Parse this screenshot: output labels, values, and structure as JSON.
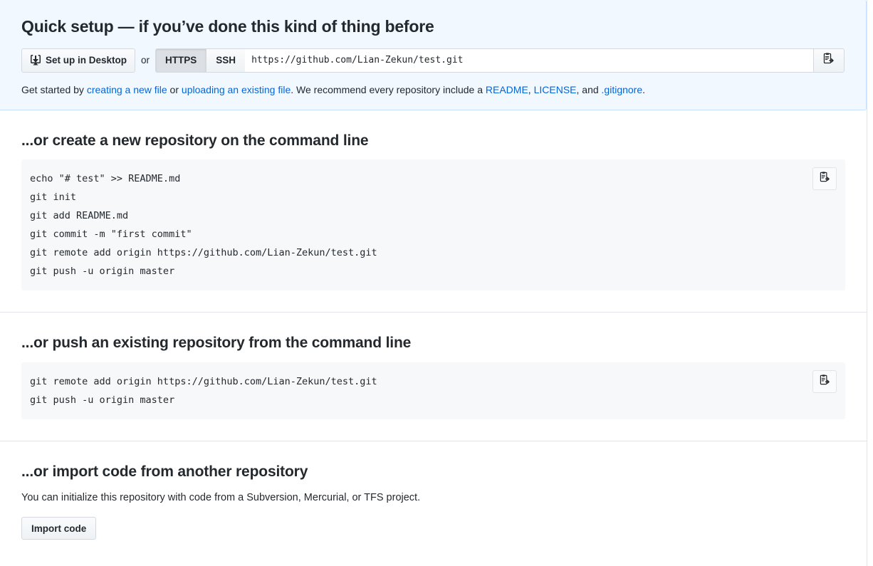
{
  "quick_setup": {
    "title": "Quick setup — if you’ve done this kind of thing before",
    "desktop_button_label": "Set up in Desktop",
    "or_label": "or",
    "protocol_https": "HTTPS",
    "protocol_ssh": "SSH",
    "selected_protocol": "HTTPS",
    "clone_url": "https://github.com/Lian-Zekun/test.git",
    "hint": {
      "prefix": "Get started by ",
      "link_new_file": "creating a new file",
      "mid_or": " or ",
      "link_upload": "uploading an existing file",
      "middle": ". We recommend every repository include a ",
      "link_readme": "README",
      "sep1": ", ",
      "link_license": "LICENSE",
      "sep2": ", and ",
      "link_gitignore": ".gitignore",
      "suffix": "."
    },
    "background_color": "#f1f8ff",
    "border_color": "#c8e1ff",
    "link_color": "#0366d6"
  },
  "create_section": {
    "title": "...or create a new repository on the command line",
    "code": "echo \"# test\" >> README.md\ngit init\ngit add README.md\ngit commit -m \"first commit\"\ngit remote add origin https://github.com/Lian-Zekun/test.git\ngit push -u origin master"
  },
  "push_section": {
    "title": "...or push an existing repository from the command line",
    "code": "git remote add origin https://github.com/Lian-Zekun/test.git\ngit push -u origin master"
  },
  "import_section": {
    "title": "...or import code from another repository",
    "description": "You can initialize this repository with code from a Subversion, Mercurial, or TFS project.",
    "button_label": "Import code"
  },
  "icons": {
    "desktop_download": "desktop-download-icon",
    "clipboard_copy": "clipboard-copy-icon"
  }
}
